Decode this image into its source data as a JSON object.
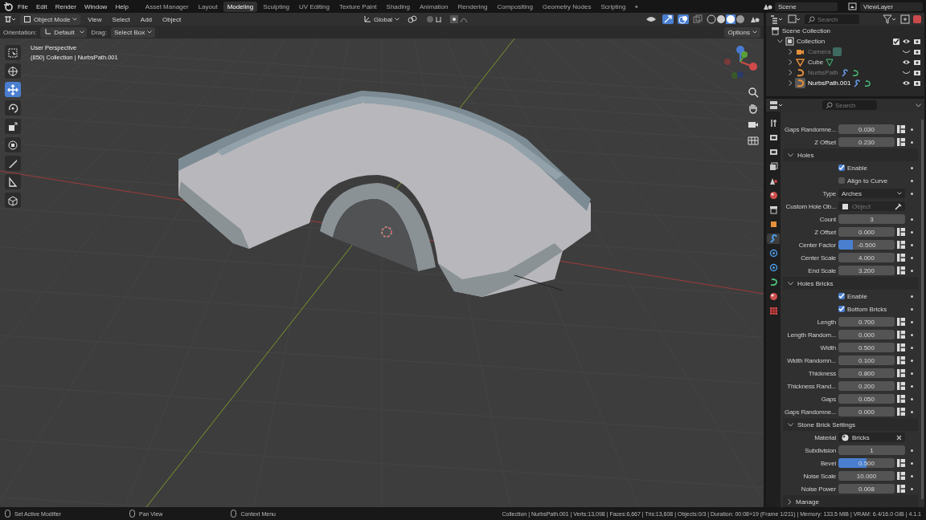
{
  "top_bar": {
    "menus": [
      "File",
      "Edit",
      "Render",
      "Window",
      "Help"
    ],
    "workspaces": [
      {
        "label": "Asset Manager",
        "selected": false
      },
      {
        "label": "Layout",
        "selected": false
      },
      {
        "label": "Modeling",
        "selected": true
      },
      {
        "label": "Sculpting",
        "selected": false
      },
      {
        "label": "UV Editing",
        "selected": false
      },
      {
        "label": "Texture Paint",
        "selected": false
      },
      {
        "label": "Shading",
        "selected": false
      },
      {
        "label": "Animation",
        "selected": false
      },
      {
        "label": "Rendering",
        "selected": false
      },
      {
        "label": "Compositing",
        "selected": false
      },
      {
        "label": "Geometry Nodes",
        "selected": false
      },
      {
        "label": "Scripting",
        "selected": false
      }
    ],
    "add_tab": "+",
    "scene": "Scene",
    "view_layer": "ViewLayer"
  },
  "viewport": {
    "header": {
      "mode": "Object Mode",
      "menus": [
        "View",
        "Select",
        "Add",
        "Object"
      ],
      "orientation": "Global"
    },
    "tool_settings": {
      "orientation_label": "Orientation:",
      "orientation": "Default",
      "drag_label": "Drag:",
      "drag": "Select Box",
      "options": "Options"
    },
    "overlay": {
      "view": "User Perspective",
      "object": "(850) Collection | NurbsPath.001"
    },
    "tools": [
      {
        "kind": "select",
        "selected": false
      },
      {
        "kind": "cursor",
        "selected": false
      },
      {
        "kind": "move",
        "selected": true
      },
      {
        "kind": "rotate",
        "selected": false
      },
      {
        "kind": "scale",
        "selected": false
      },
      {
        "kind": "transform",
        "selected": false
      },
      {
        "kind": "annotate",
        "selected": false
      },
      {
        "kind": "measure",
        "selected": false
      },
      {
        "kind": "add-cube",
        "selected": false
      }
    ]
  },
  "outliner": {
    "search_placeholder": "Search",
    "root": "Scene Collection",
    "items": [
      {
        "label": "Collection",
        "kind": "collection",
        "checked": true,
        "visible": true,
        "children": [
          {
            "label": "Camera",
            "kind": "camera",
            "visible": false,
            "selected": false
          },
          {
            "label": "Cube",
            "kind": "mesh",
            "visible": true,
            "selected": false
          },
          {
            "label": "NurbsPath",
            "kind": "curve",
            "visible": false,
            "selected": false
          },
          {
            "label": "NurbsPath.001",
            "kind": "curve",
            "visible": true,
            "selected": true
          }
        ]
      }
    ]
  },
  "properties": {
    "search_placeholder": "Search",
    "tabs": [
      {
        "kind": "tool",
        "selected": false
      },
      {
        "kind": "render",
        "selected": false
      },
      {
        "kind": "output",
        "selected": false
      },
      {
        "kind": "view-layer",
        "selected": false
      },
      {
        "kind": "scene",
        "selected": false
      },
      {
        "kind": "world",
        "selected": false
      },
      {
        "kind": "collection",
        "selected": false
      },
      {
        "kind": "object",
        "selected": false
      },
      {
        "kind": "modifier",
        "selected": true
      },
      {
        "kind": "particles",
        "selected": false
      },
      {
        "kind": "physics",
        "selected": false
      },
      {
        "kind": "data",
        "selected": false
      },
      {
        "kind": "material",
        "selected": false
      },
      {
        "kind": "texture",
        "selected": false
      }
    ],
    "rows": [
      {
        "kind": "number",
        "label": "Gaps Randomne...",
        "value": "0.030"
      },
      {
        "kind": "number",
        "label": "Z Offset",
        "value": "0.230"
      },
      {
        "kind": "header",
        "label": "Holes",
        "expanded": true
      },
      {
        "kind": "checkbox",
        "label": "Enable",
        "checked": true
      },
      {
        "kind": "checkbox",
        "label": "Align to Curve",
        "checked": false
      },
      {
        "kind": "dropdown",
        "label": "Type",
        "value": "Arches"
      },
      {
        "kind": "object",
        "label": "Custom Hole Ob...",
        "placeholder": "Object"
      },
      {
        "kind": "int",
        "label": "Count",
        "value": "3"
      },
      {
        "kind": "number",
        "label": "Z Offset",
        "value": "0.000"
      },
      {
        "kind": "number",
        "label": "Center Factor",
        "value": "-0.500",
        "level": 0.25
      },
      {
        "kind": "number",
        "label": "Center Scale",
        "value": "4.000"
      },
      {
        "kind": "number",
        "label": "End Scale",
        "value": "3.200"
      },
      {
        "kind": "header",
        "label": "Holes Bricks",
        "expanded": true
      },
      {
        "kind": "checkbox",
        "label": "Enable",
        "checked": true
      },
      {
        "kind": "checkbox",
        "label": "Bottom Bricks",
        "checked": true
      },
      {
        "kind": "number",
        "label": "Length",
        "value": "0.700"
      },
      {
        "kind": "number",
        "label": "Length Random...",
        "value": "0.000"
      },
      {
        "kind": "number",
        "label": "Width",
        "value": "0.500"
      },
      {
        "kind": "number",
        "label": "Width Randomn...",
        "value": "0.100"
      },
      {
        "kind": "number",
        "label": "Thickness",
        "value": "0.800"
      },
      {
        "kind": "number",
        "label": "Thickness Rand...",
        "value": "0.200"
      },
      {
        "kind": "number",
        "label": "Gaps",
        "value": "0.050"
      },
      {
        "kind": "number",
        "label": "Gaps Randomne...",
        "value": "0.000"
      },
      {
        "kind": "header",
        "label": "Stone Brick Settings",
        "expanded": true
      },
      {
        "kind": "material",
        "label": "Material",
        "value": "Bricks"
      },
      {
        "kind": "int",
        "label": "Subdivision",
        "value": "1"
      },
      {
        "kind": "number",
        "label": "Bevel",
        "value": "0.500",
        "level": 0.5
      },
      {
        "kind": "number",
        "label": "Noise Scale",
        "value": "10.000"
      },
      {
        "kind": "number",
        "label": "Noise Power",
        "value": "0.008"
      },
      {
        "kind": "header",
        "label": "Manage",
        "expanded": false
      }
    ]
  },
  "status_bar": {
    "hints": [
      "Set Active Modifier",
      "Pan View",
      "Context Menu"
    ],
    "stats": "Collection | NurbsPath.001 | Verts:13,098 | Faces:6,667 | Tris:13,608 | Objects:0/3 | Duration: 00:08+19 (Frame 1/211) | Memory: 133.5 MiB | VRAM: 6.4/16.0 GiB | 4.1.1"
  }
}
